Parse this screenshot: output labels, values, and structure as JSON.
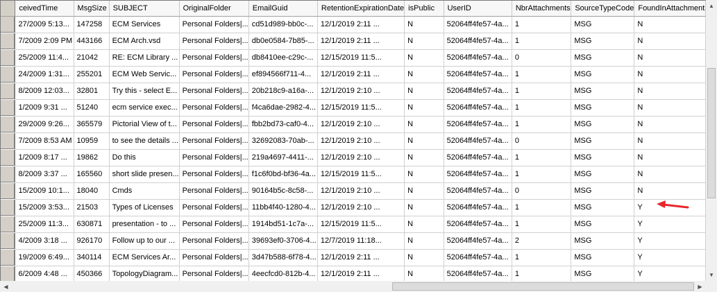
{
  "columns": [
    "ceivedTime",
    "MsgSize",
    "SUBJECT",
    "OriginalFolder",
    "EmailGuid",
    "RetentionExpirationDate",
    "isPublic",
    "UserID",
    "NbrAttachments",
    "SourceTypeCode",
    "FoundInAttachment"
  ],
  "rows": [
    [
      "27/2009 5:13...",
      "147258",
      "ECM Services",
      "Personal Folders|...",
      "cd51d989-bb0c-...",
      "12/1/2019 2:11 ...",
      "N",
      "52064ff4fe57-4a...",
      "1",
      "MSG",
      "N"
    ],
    [
      "7/2009 2:09 PM",
      "443166",
      "ECM Arch.vsd",
      "Personal Folders|...",
      "db0e0584-7b85-...",
      "12/1/2019 2:11 ...",
      "N",
      "52064ff4fe57-4a...",
      "1",
      "MSG",
      "N"
    ],
    [
      "25/2009 11:4...",
      "21042",
      "RE: ECM Library ...",
      "Personal Folders|...",
      "db8410ee-c29c-...",
      "12/15/2019 11:5...",
      "N",
      "52064ff4fe57-4a...",
      "0",
      "MSG",
      "N"
    ],
    [
      "24/2009 1:31...",
      "255201",
      "ECM Web Servic...",
      "Personal Folders|...",
      "ef894566f711-4...",
      "12/1/2019 2:11 ...",
      "N",
      "52064ff4fe57-4a...",
      "1",
      "MSG",
      "N"
    ],
    [
      "8/2009 12:03...",
      "32801",
      "Try this - select E...",
      "Personal Folders|...",
      "20b218c9-a16a-...",
      "12/1/2019 2:10 ...",
      "N",
      "52064ff4fe57-4a...",
      "1",
      "MSG",
      "N"
    ],
    [
      "1/2009 9:31 ...",
      "51240",
      "ecm service exec...",
      "Personal Folders|...",
      "f4ca6dae-2982-4...",
      "12/15/2019 11:5...",
      "N",
      "52064ff4fe57-4a...",
      "1",
      "MSG",
      "N"
    ],
    [
      "29/2009 9:26...",
      "365579",
      "Pictorial View of t...",
      "Personal Folders|...",
      "fbb2bd73-caf0-4...",
      "12/1/2019 2:10 ...",
      "N",
      "52064ff4fe57-4a...",
      "1",
      "MSG",
      "N"
    ],
    [
      "7/2009 8:53 AM",
      "10959",
      "to see the details ...",
      "Personal Folders|...",
      "32692083-70ab-...",
      "12/1/2019 2:10 ...",
      "N",
      "52064ff4fe57-4a...",
      "0",
      "MSG",
      "N"
    ],
    [
      "1/2009 8:17 ...",
      "19862",
      "Do this",
      "Personal Folders|...",
      "219a4697-4411-...",
      "12/1/2019 2:10 ...",
      "N",
      "52064ff4fe57-4a...",
      "1",
      "MSG",
      "N"
    ],
    [
      "8/2009 3:37 ...",
      "165560",
      "short slide presen...",
      "Personal Folders|...",
      "f1c6f0bd-bf36-4a...",
      "12/15/2019 11:5...",
      "N",
      "52064ff4fe57-4a...",
      "1",
      "MSG",
      "N"
    ],
    [
      "15/2009 10:1...",
      "18040",
      "Cmds",
      "Personal Folders|...",
      "90164b5c-8c58-...",
      "12/1/2019 2:10 ...",
      "N",
      "52064ff4fe57-4a...",
      "0",
      "MSG",
      "N"
    ],
    [
      "15/2009 3:53...",
      "21503",
      "Types of Licenses",
      "Personal Folders|...",
      "11bb4f40-1280-4...",
      "12/1/2019 2:10 ...",
      "N",
      "52064ff4fe57-4a...",
      "1",
      "MSG",
      "Y"
    ],
    [
      "25/2009 11:3...",
      "630871",
      "presentation - to ...",
      "Personal Folders|...",
      "1914bd51-1c7a-...",
      "12/15/2019 11:5...",
      "N",
      "52064ff4fe57-4a...",
      "1",
      "MSG",
      "Y"
    ],
    [
      "4/2009 3:18 ...",
      "926170",
      "Follow up to our ...",
      "Personal Folders|...",
      "39693ef0-3706-4...",
      "12/7/2019 11:18...",
      "N",
      "52064ff4fe57-4a...",
      "2",
      "MSG",
      "Y"
    ],
    [
      "19/2009 6:49...",
      "340114",
      "ECM Services Ar...",
      "Personal Folders|...",
      "3d47b588-6f78-4...",
      "12/1/2019 2:11 ...",
      "N",
      "52064ff4fe57-4a...",
      "1",
      "MSG",
      "Y"
    ],
    [
      "6/2009 4:48 ...",
      "450366",
      "TopologyDiagram...",
      "Personal Folders|...",
      "4eecfcd0-812b-4...",
      "12/1/2019 2:11 ...",
      "N",
      "52064ff4fe57-4a...",
      "1",
      "MSG",
      "Y"
    ]
  ],
  "icons": {
    "scroll_up": "▲",
    "scroll_down": "▼",
    "scroll_left": "◀",
    "scroll_right": "▶"
  },
  "colors": {
    "annotation_arrow": "#e8262a",
    "row_header": "#d4d0c8"
  }
}
